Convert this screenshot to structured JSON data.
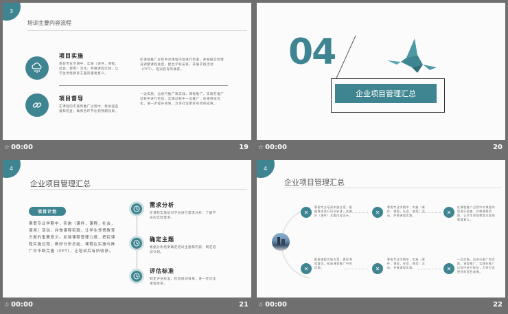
{
  "slides": [
    {
      "number": "19",
      "footer_time": "00:00",
      "badge": "3",
      "header": "培训主要内容流程",
      "items": [
        {
          "title": "项目实施",
          "text": "寒假专业学期中，实施（课件，课程，社会，使用）活动，并做课程实践，让学生领悟教育方面的重要意义。",
          "side_text": "在课程推广过程中对课程内容进行检查，并根据实际情况调整课程进度，配合学校安排，开展实践活动（PPT），培训后有所收获。"
        },
        {
          "title": "项目督导",
          "text": "在课程的实施和推广过程中，要加强监督和检查，确保各环节达到预期效果。",
          "side_text": "一边实施，边进行推广和实践，课程推广，实践在推广过程中进行检验，实施过程中一边推广，效果持续优化，进一步提升效果，力争打造更好的项目成果。"
        }
      ]
    },
    {
      "number": "20",
      "footer_time": "00:00",
      "big_number": "04",
      "section_title": "企业项目管理汇总"
    },
    {
      "number": "21",
      "footer_time": "00:00",
      "badge": "4",
      "header": "企业项目管理汇总",
      "pill": "项目计划",
      "body": "寒假专业学期中，实施（课件，课程，社会，使用）活动，并做课程实践，让学生领悟教育方面的重要意义。加强课程管理力度，把控课程实施过程，做好分析总结，课程在实施与推广中不断完善（PPT），让培训后有所收获。",
      "steps": [
        {
          "title": "需求分析",
          "text": "在课程实施前对学员进行需求分析，了解学员的实际需求。"
        },
        {
          "title": "确定主题",
          "text": "根据分析结果确定培训主题和内容，制定培训计划。"
        },
        {
          "title": "评估标准",
          "text": "制定评估标准，检验培训效果，进一步优化课程体系。"
        }
      ]
    },
    {
      "number": "22",
      "footer_time": "00:00",
      "badge": "4",
      "header": "企业项目管理汇总",
      "cards": [
        {
          "text": "寒假专业培训实施方案，根据需求进行培训安排，并做好（课件）主题内容设计。"
        },
        {
          "text": "寒假专业学期中，实施（课件，课程，社会，使用）活动，并做课程实践。"
        },
        {
          "text": "在课程推广过程中对课程内容进行检查，并做课程实践，让学生领悟教育方面的重要意义。"
        },
        {
          "text": "根据课程实施方案，做好课程督导，检查课程推广中的问题。"
        },
        {
          "text": "寒假专业学期中，实施（课件，课程，社会，使用）活动，并做课程实践。"
        },
        {
          "text": "一边实施，边进行推广和实践，课程推广，实践在推广过程中进行检验，力争打造更好的项目成果。"
        }
      ]
    }
  ],
  "colors": {
    "accent": "#3e8591",
    "backdrop": "#6f6f6f"
  }
}
